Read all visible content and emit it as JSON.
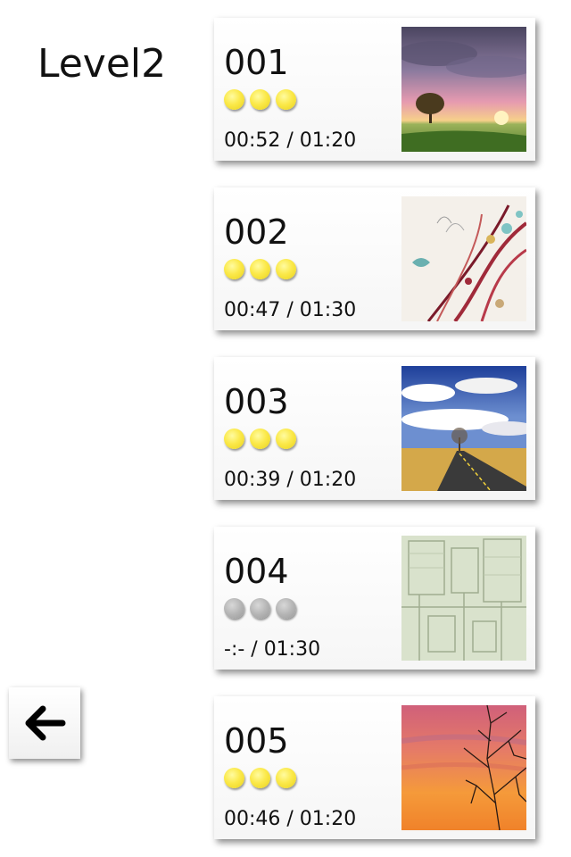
{
  "screen": {
    "title": "Level2"
  },
  "back_button": {
    "icon": "arrow-left-icon"
  },
  "colors": {
    "star_earned": "#f7e34a",
    "star_empty": "#b5b5b5",
    "card_background": "#f8f8f8"
  },
  "levels": [
    {
      "number": "001",
      "stars_earned": 3,
      "stars_total": 3,
      "time": "00:52 / 01:20",
      "thumbnail": "sunset-tree-field"
    },
    {
      "number": "002",
      "stars_earned": 3,
      "stars_total": 3,
      "time": "00:47 / 01:30",
      "thumbnail": "floral-swirl-art"
    },
    {
      "number": "003",
      "stars_earned": 3,
      "stars_total": 3,
      "time": "00:39 / 01:20",
      "thumbnail": "road-cloudy-sky"
    },
    {
      "number": "004",
      "stars_earned": 0,
      "stars_total": 3,
      "time": "-:- / 01:30",
      "thumbnail": "faded-industrial-machinery"
    },
    {
      "number": "005",
      "stars_earned": 3,
      "stars_total": 3,
      "time": "00:46 / 01:20",
      "thumbnail": "orange-sunset-branches"
    }
  ]
}
